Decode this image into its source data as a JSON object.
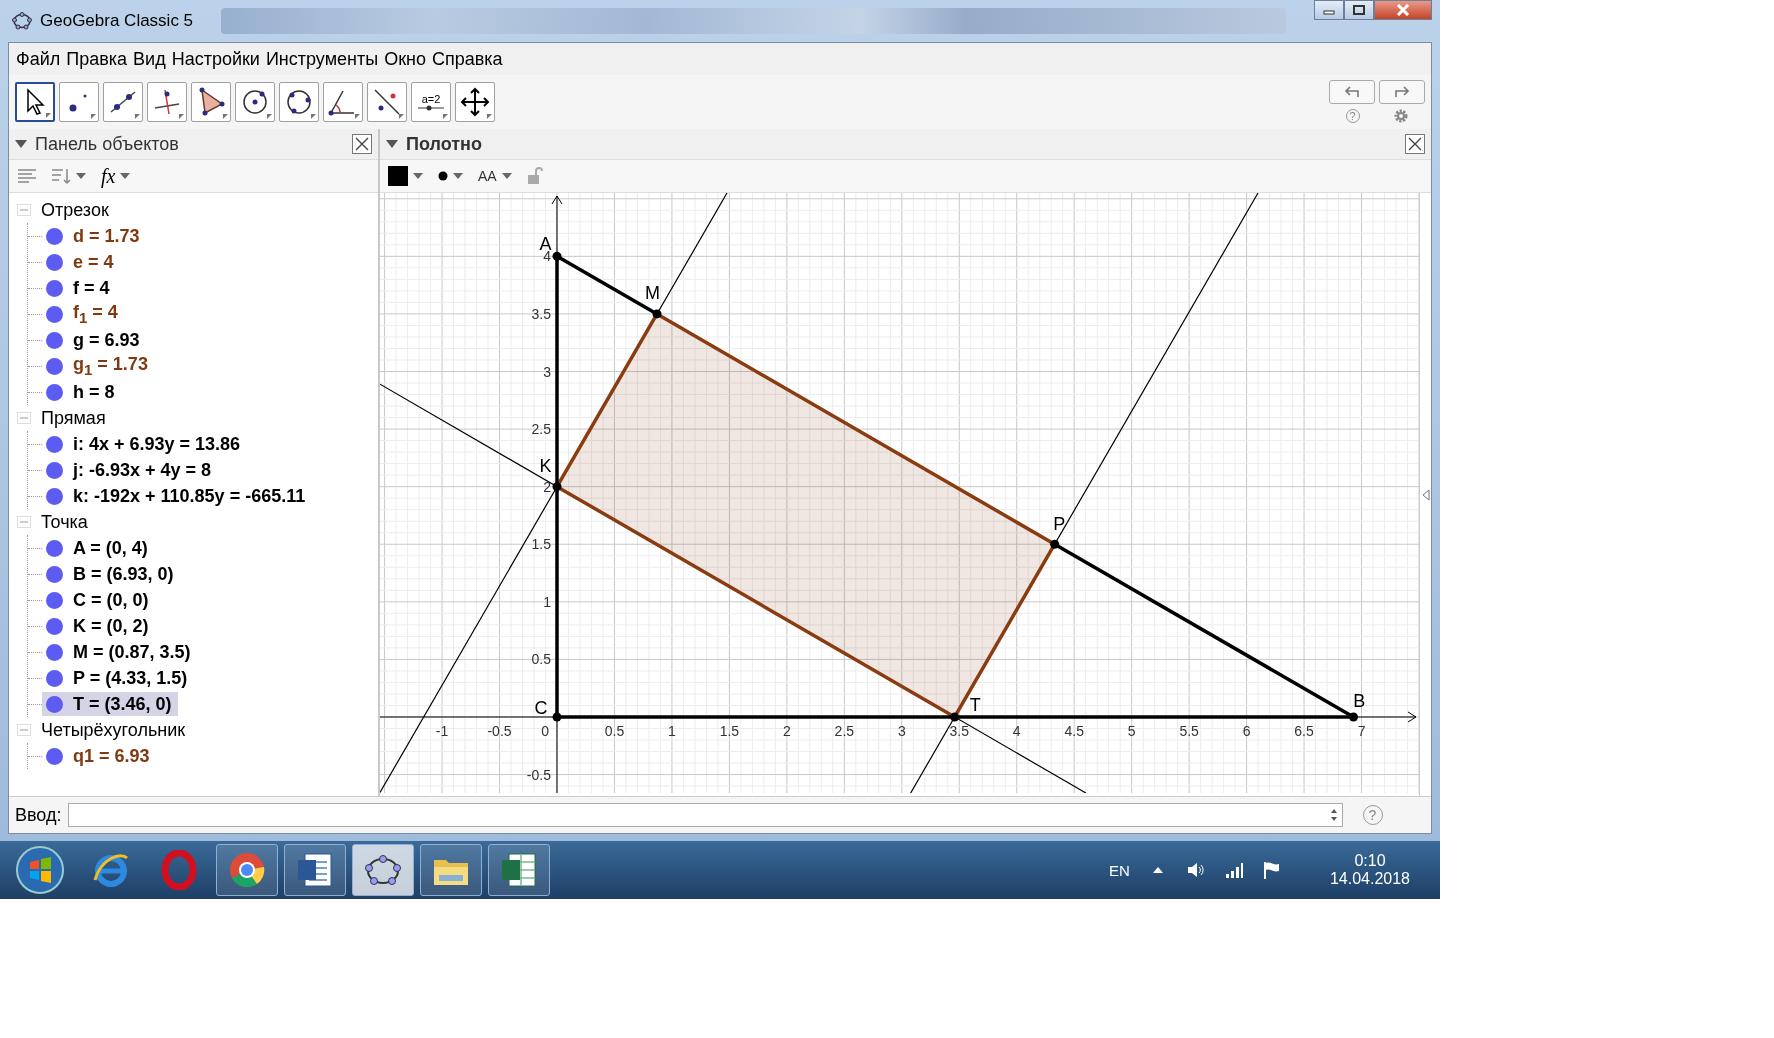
{
  "window": {
    "title": "GeoGebra Classic 5"
  },
  "menu": [
    "Файл",
    "Правка",
    "Вид",
    "Настройки",
    "Инструменты",
    "Окно",
    "Справка"
  ],
  "toolbar": {
    "tools": [
      {
        "kind": "move",
        "selected": true
      },
      {
        "kind": "point",
        "selected": false
      },
      {
        "kind": "line",
        "selected": false
      },
      {
        "kind": "perpendicular",
        "selected": false
      },
      {
        "kind": "polygon",
        "selected": false
      },
      {
        "kind": "circle",
        "selected": false
      },
      {
        "kind": "circle3",
        "selected": false
      },
      {
        "kind": "angle",
        "selected": false
      },
      {
        "kind": "reflect",
        "selected": false
      },
      {
        "kind": "slider",
        "label": "a=2",
        "selected": false
      },
      {
        "kind": "move_view",
        "selected": false
      }
    ],
    "help": "?"
  },
  "algebra_panel": {
    "title": "Панель объектов",
    "style_bar": {
      "function_label": "fx"
    },
    "groups": [
      {
        "title": "Отрезок",
        "expanded": true,
        "items": [
          {
            "text": "d = 1.73",
            "color": "#7f3a10",
            "selected": false
          },
          {
            "text": "e = 4",
            "color": "#7f3a10",
            "selected": false
          },
          {
            "text": "f = 4",
            "color": "#000000",
            "selected": false
          },
          {
            "text": "f$_{1}$ = 4",
            "color": "#7f3a10",
            "selected": false
          },
          {
            "text": "g = 6.93",
            "color": "#000000",
            "selected": false
          },
          {
            "text": "g$_{1}$ = 1.73",
            "color": "#7f3a10",
            "selected": false
          },
          {
            "text": "h = 8",
            "color": "#000000",
            "selected": false
          }
        ]
      },
      {
        "title": "Прямая",
        "expanded": true,
        "items": [
          {
            "text": "i: 4x + 6.93y = 13.86",
            "color": "#000000",
            "selected": false
          },
          {
            "text": "j: -6.93x + 4y = 8",
            "color": "#000000",
            "selected": false
          },
          {
            "text": "k: -192x + 110.85y = -665.11",
            "color": "#000000",
            "selected": false
          }
        ]
      },
      {
        "title": "Точка",
        "expanded": true,
        "items": [
          {
            "text": "A = (0, 4)",
            "color": "#000000",
            "selected": false
          },
          {
            "text": "B = (6.93, 0)",
            "color": "#000000",
            "selected": false
          },
          {
            "text": "C = (0, 0)",
            "color": "#000000",
            "selected": false
          },
          {
            "text": "K = (0, 2)",
            "color": "#000000",
            "selected": false
          },
          {
            "text": "M = (0.87, 3.5)",
            "color": "#000000",
            "selected": false
          },
          {
            "text": "P = (4.33, 1.5)",
            "color": "#000000",
            "selected": false
          },
          {
            "text": "T = (3.46, 0)",
            "color": "#000000",
            "selected": true
          }
        ]
      },
      {
        "title": "Четырёхугольник",
        "expanded": true,
        "items": [
          {
            "text": "q1 = 6.93",
            "color": "#7f3a10",
            "selected": false
          }
        ]
      }
    ]
  },
  "graphics_panel": {
    "title": "Полотно",
    "style_bar": {
      "label_style": "AA"
    },
    "canvas": {
      "x_axis_labels": [
        "-1",
        "-0.5",
        "0",
        "0.5",
        "1",
        "1.5",
        "2",
        "2.5",
        "3",
        "3.5",
        "4",
        "4.5",
        "5",
        "5.5",
        "6",
        "6.5",
        "7"
      ],
      "y_axis_labels": [
        "4",
        "3.5",
        "3",
        "2.5",
        "2",
        "1.5",
        "1",
        "0.5",
        "-0.5"
      ],
      "point_labels": [
        "A",
        "M",
        "K",
        "P",
        "C",
        "T",
        "B"
      ]
    }
  },
  "input_bar": {
    "label": "Ввод:",
    "help": "?"
  },
  "taskbar": {
    "apps": [
      {
        "kind": "ie",
        "running": false,
        "active": false
      },
      {
        "kind": "opera",
        "running": false,
        "active": false
      },
      {
        "kind": "chrome",
        "running": true,
        "active": false
      },
      {
        "kind": "word",
        "running": true,
        "active": false
      },
      {
        "kind": "geogebra",
        "running": true,
        "active": true
      },
      {
        "kind": "folder",
        "running": true,
        "active": false
      },
      {
        "kind": "excel",
        "running": true,
        "active": false
      }
    ],
    "language": "EN",
    "time": "0:10",
    "date": "14.04.2018"
  }
}
